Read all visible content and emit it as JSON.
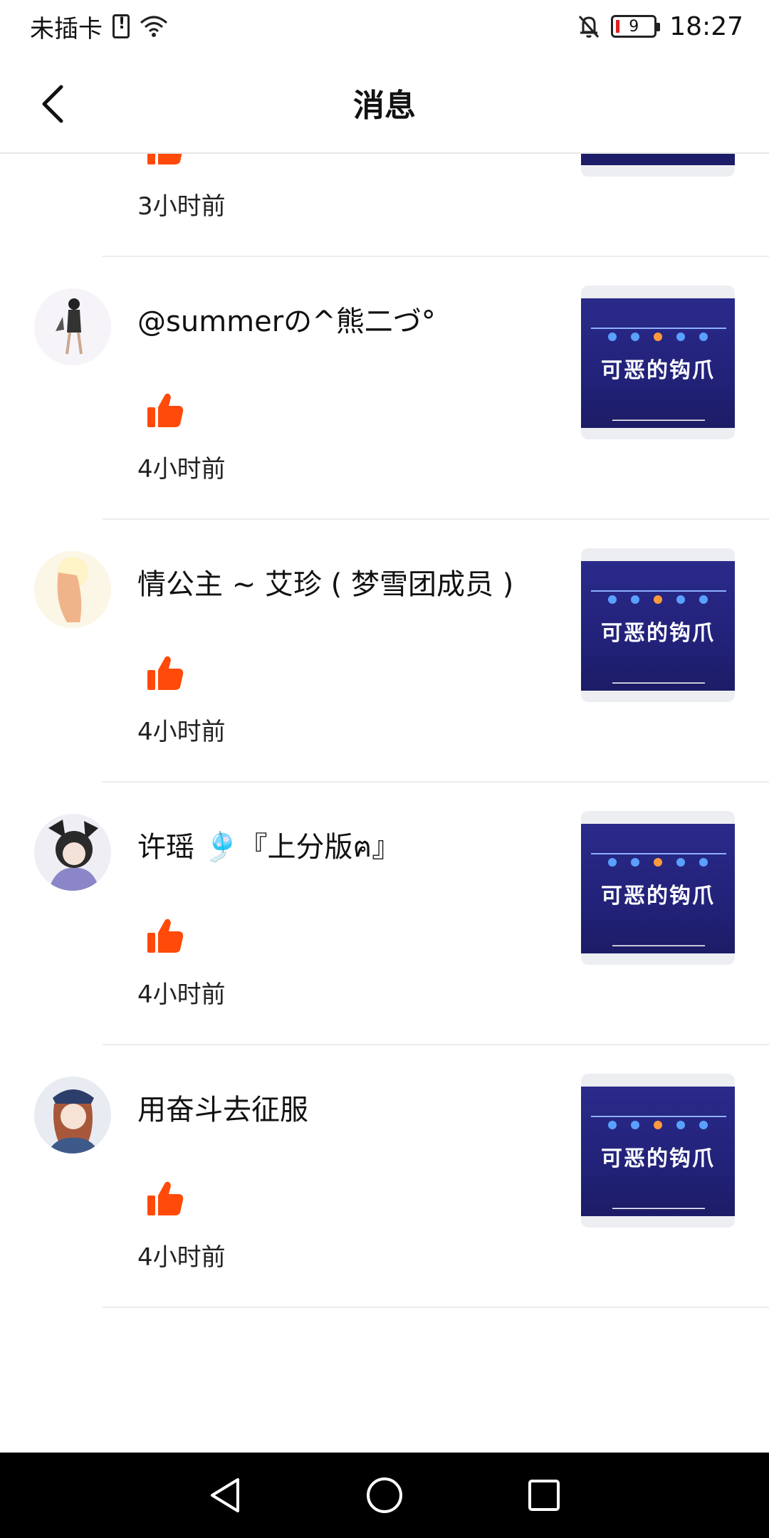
{
  "status_bar": {
    "carrier": "未插卡",
    "battery_level": "9",
    "time": "18:27"
  },
  "header": {
    "title": "消息"
  },
  "thumbnail_text": "可恶的钩爪",
  "items": [
    {
      "username": "",
      "time_ago": "3小时前"
    },
    {
      "username": "@summerの^熊二づ°",
      "time_ago": "4小时前"
    },
    {
      "username": "情公主 ~ 艾珍 ( 梦雪团成员 )",
      "time_ago": "4小时前"
    },
    {
      "username": "许瑶 🎐『上分版ฅ』",
      "time_ago": "4小时前"
    },
    {
      "username": "用奋斗去征服",
      "time_ago": "4小时前"
    }
  ],
  "colors": {
    "like": "#ff4a0a",
    "nav_bar": "#000000",
    "divider": "#ececec"
  }
}
